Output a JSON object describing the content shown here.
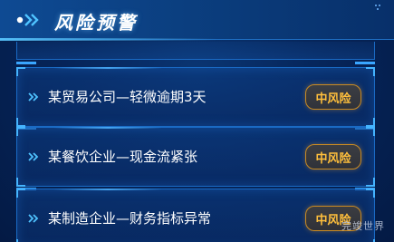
{
  "header": {
    "title": "风险预警",
    "icon": "double-chevron-right-icon"
  },
  "alerts": [
    {
      "text": "某贸易公司—轻微逾期3天",
      "level": "中风险"
    },
    {
      "text": "某餐饮企业—现金流紧张",
      "level": "中风险"
    },
    {
      "text": "某制造企业—财务指标异常",
      "level": "中风险"
    }
  ],
  "colors": {
    "accent": "#45b4ff",
    "badge_text": "#ffbf3c",
    "badge_border": "#c98a22",
    "background": "#06255a"
  },
  "watermark": "完竣世界"
}
